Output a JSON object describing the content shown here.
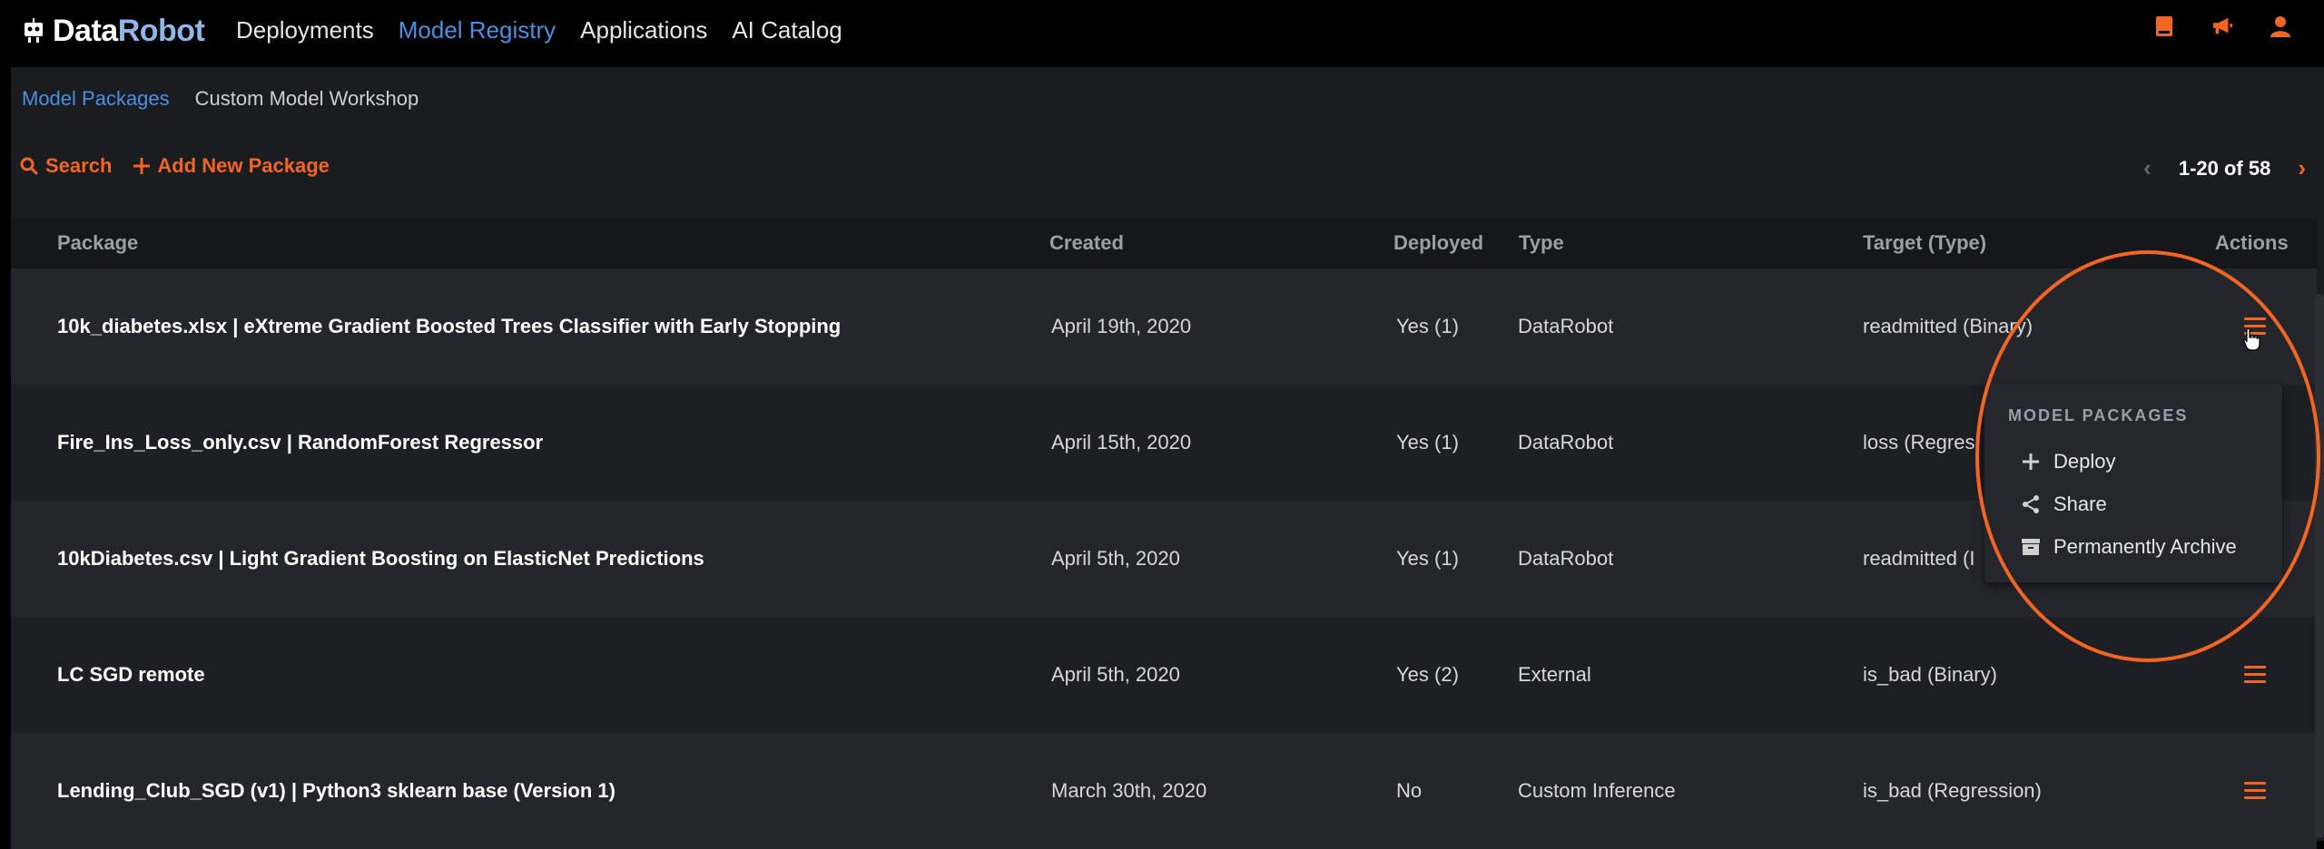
{
  "app": {
    "logo_part1": "Data",
    "logo_part2": "Robot"
  },
  "nav": [
    {
      "label": "Deployments",
      "active": false
    },
    {
      "label": "Model Registry",
      "active": true
    },
    {
      "label": "Applications",
      "active": false
    },
    {
      "label": "AI Catalog",
      "active": false
    }
  ],
  "top_icons": [
    "book-icon",
    "megaphone-icon",
    "user-icon"
  ],
  "subtabs": {
    "active": "Model Packages",
    "inactive": "Custom Model Workshop"
  },
  "toolbar": {
    "search_label": "Search",
    "add_label": "Add New Package"
  },
  "pager": {
    "range": "1-20 of 58"
  },
  "table": {
    "headers": {
      "package": "Package",
      "created": "Created",
      "deployed": "Deployed",
      "type": "Type",
      "target": "Target (Type)",
      "actions": "Actions"
    },
    "rows": [
      {
        "package": "10k_diabetes.xlsx | eXtreme Gradient Boosted Trees Classifier with Early Stopping",
        "created": "April 19th, 2020",
        "deployed": "Yes (1)",
        "type": "DataRobot",
        "target": "readmitted (Binary)"
      },
      {
        "package": "Fire_Ins_Loss_only.csv | RandomForest Regressor",
        "created": "April 15th, 2020",
        "deployed": "Yes (1)",
        "type": "DataRobot",
        "target": "loss (Regres"
      },
      {
        "package": "10kDiabetes.csv | Light Gradient Boosting on ElasticNet Predictions",
        "created": "April 5th, 2020",
        "deployed": "Yes (1)",
        "type": "DataRobot",
        "target": "readmitted (I"
      },
      {
        "package": "LC SGD remote",
        "created": "April 5th, 2020",
        "deployed": "Yes (2)",
        "type": "External",
        "target": "is_bad (Binary)"
      },
      {
        "package": "Lending_Club_SGD (v1) | Python3 sklearn base (Version 1)",
        "created": "March 30th, 2020",
        "deployed": "No",
        "type": "Custom Inference",
        "target": "is_bad (Regression)"
      }
    ]
  },
  "dropdown": {
    "title": "MODEL PACKAGES",
    "items": [
      {
        "label": "Deploy",
        "icon": "plus-icon"
      },
      {
        "label": "Share",
        "icon": "share-icon"
      },
      {
        "label": "Permanently Archive",
        "icon": "archive-icon"
      }
    ]
  },
  "colors": {
    "accent": "#f26522",
    "link": "#4a90e2",
    "background": "#1b1c20"
  }
}
